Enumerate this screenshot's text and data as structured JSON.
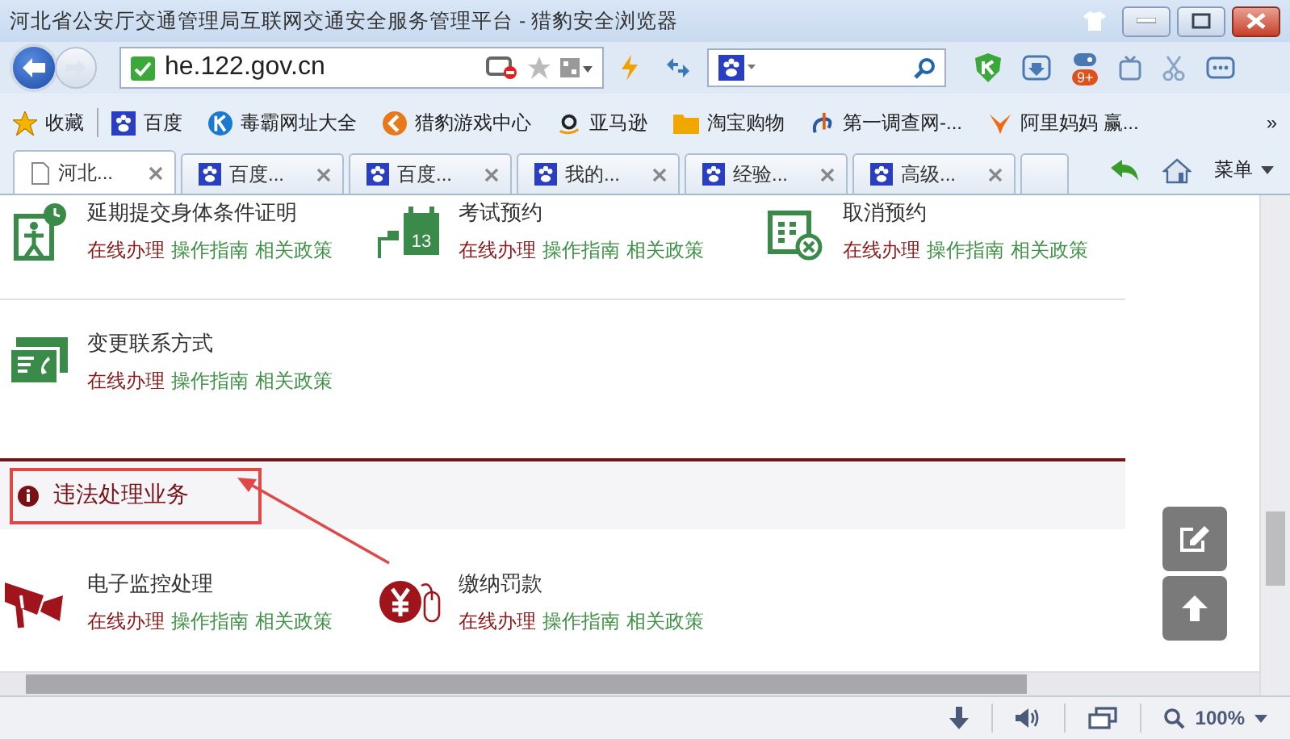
{
  "window": {
    "title": "河北省公安厅交通管理局互联网交通安全服务管理平台 - 猎豹安全浏览器"
  },
  "address_bar": {
    "url": "he.122.gov.cn"
  },
  "toolbar": {
    "badge": "9+"
  },
  "bookmarks": [
    {
      "label": "收藏",
      "kind": "star"
    },
    {
      "label": "百度",
      "kind": "paw"
    },
    {
      "label": "毒霸网址大全",
      "kind": "k"
    },
    {
      "label": "猎豹游戏中心",
      "kind": "game"
    },
    {
      "label": "亚马逊",
      "kind": "amazon"
    },
    {
      "label": "淘宝购物",
      "kind": "folder"
    },
    {
      "label": "第一调查网-...",
      "kind": "survey"
    },
    {
      "label": "阿里妈妈 赢...",
      "kind": "ali"
    }
  ],
  "bookmarks_more": "»",
  "tabs": [
    {
      "label": "河北...",
      "kind": "page",
      "selected": true
    },
    {
      "label": "百度...",
      "kind": "paw",
      "selected": false
    },
    {
      "label": "百度...",
      "kind": "paw",
      "selected": false
    },
    {
      "label": "我的...",
      "kind": "paw",
      "selected": false
    },
    {
      "label": "经验...",
      "kind": "paw",
      "selected": false
    },
    {
      "label": "高级...",
      "kind": "paw",
      "selected": false
    }
  ],
  "menu_label": "菜单",
  "service_rows": [
    [
      {
        "title": "延期提交身体条件证明",
        "kind": "person",
        "actions": [
          "在线办理",
          "操作指南",
          "相关政策"
        ]
      },
      {
        "title": "考试预约",
        "kind": "calendar",
        "icon_text": "13",
        "actions": [
          "在线办理",
          "操作指南",
          "相关政策"
        ]
      },
      {
        "title": "取消预约",
        "kind": "cancel",
        "actions": [
          "在线办理",
          "操作指南",
          "相关政策"
        ]
      }
    ],
    [
      {
        "title": "变更联系方式",
        "kind": "phone",
        "actions": [
          "在线办理",
          "操作指南",
          "相关政策"
        ]
      }
    ]
  ],
  "section": {
    "title": "违法处理业务",
    "rows": [
      [
        {
          "title": "电子监控处理",
          "kind": "camera",
          "actions": [
            "在线办理",
            "操作指南",
            "相关政策"
          ]
        },
        {
          "title": "缴纳罚款",
          "kind": "yen",
          "actions": [
            "在线办理",
            "操作指南",
            "相关政策"
          ]
        }
      ]
    ]
  },
  "status_bar": {
    "zoom": "100%"
  }
}
